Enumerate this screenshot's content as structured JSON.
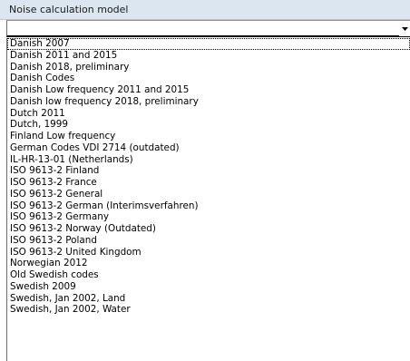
{
  "header": {
    "label": "Noise calculation model"
  },
  "combo": {
    "value": "",
    "arrow_icon": "chevron-down-icon"
  },
  "dropdown": {
    "focused_index": 0,
    "items": [
      "Danish 2007",
      "Danish 2011 and 2015",
      "Danish 2018, preliminary",
      "Danish Codes",
      "Danish Low frequency 2011 and 2015",
      "Danish low frequency 2018, preliminary",
      "Dutch 2011",
      "Dutch, 1999",
      "Finland Low frequency",
      "German Codes VDI 2714 (outdated)",
      "IL-HR-13-01 (Netherlands)",
      "ISO 9613-2 Finland",
      "ISO 9613-2 France",
      "ISO 9613-2 General",
      "ISO 9613-2 German (Interimsverfahren)",
      "ISO 9613-2 Germany",
      "ISO 9613-2 Norway (Outdated)",
      "ISO 9613-2 Poland",
      "ISO 9613-2 United Kingdom",
      "Norwegian 2012",
      "Old Swedish codes",
      "Swedish 2009",
      "Swedish, Jan 2002, Land",
      "Swedish, Jan 2002, Water"
    ]
  },
  "colors": {
    "header_background": "#dce6f1",
    "list_background": "#ffffff",
    "text": "#000000"
  }
}
